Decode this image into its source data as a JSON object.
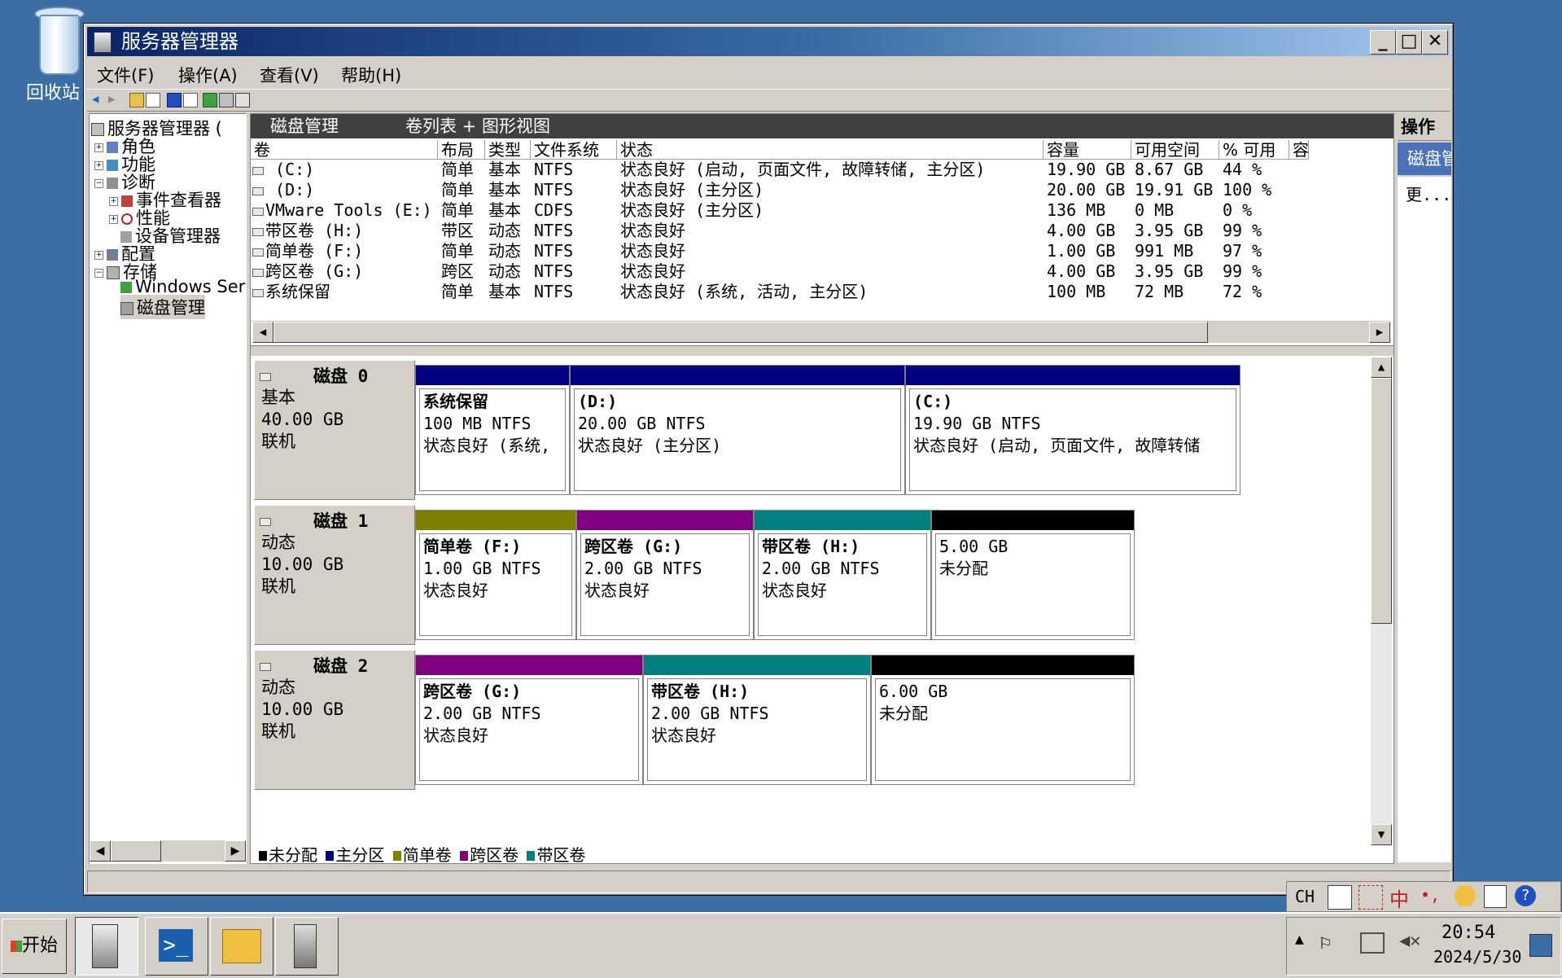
{
  "desktop": {
    "recycle_bin_label": "回收站"
  },
  "window": {
    "title": "服务器管理器",
    "controls": {
      "minimize": "_",
      "maximize": "□",
      "close": "✕"
    }
  },
  "menu": {
    "file": "文件(F)",
    "action": "操作(A)",
    "view": "查看(V)",
    "help": "帮助(H)"
  },
  "tree": {
    "root": "服务器管理器 (",
    "items": [
      {
        "label": "角色"
      },
      {
        "label": "功能"
      },
      {
        "label": "诊断"
      },
      {
        "label": "事件查看器"
      },
      {
        "label": "性能"
      },
      {
        "label": "设备管理器"
      },
      {
        "label": "配置"
      },
      {
        "label": "存储"
      },
      {
        "label": "Windows Ser"
      },
      {
        "label": "磁盘管理"
      }
    ]
  },
  "center": {
    "title": "磁盘管理",
    "view_label": "卷列表 + 图形视图",
    "columns": [
      "卷",
      "布局",
      "类型",
      "文件系统",
      "状态",
      "容量",
      "可用空间",
      "% 可用",
      "容"
    ],
    "rows": [
      {
        "vol": " (C:)",
        "layout": "简单",
        "type": "基本",
        "fs": "NTFS",
        "status": "状态良好 (启动, 页面文件, 故障转储, 主分区)",
        "cap": "19.90 GB",
        "free": "8.67 GB",
        "pct": "44 %"
      },
      {
        "vol": " (D:)",
        "layout": "简单",
        "type": "基本",
        "fs": "NTFS",
        "status": "状态良好 (主分区)",
        "cap": "20.00 GB",
        "free": "19.91 GB",
        "pct": "100 %"
      },
      {
        "vol": "VMware Tools (E:)",
        "layout": "简单",
        "type": "基本",
        "fs": "CDFS",
        "status": "状态良好 (主分区)",
        "cap": "136 MB",
        "free": "0 MB",
        "pct": "0 %"
      },
      {
        "vol": "带区卷 (H:)",
        "layout": "带区",
        "type": "动态",
        "fs": "NTFS",
        "status": "状态良好",
        "cap": "4.00 GB",
        "free": "3.95 GB",
        "pct": "99 %"
      },
      {
        "vol": "简单卷 (F:)",
        "layout": "简单",
        "type": "动态",
        "fs": "NTFS",
        "status": "状态良好",
        "cap": "1.00 GB",
        "free": "991 MB",
        "pct": "97 %"
      },
      {
        "vol": "跨区卷 (G:)",
        "layout": "跨区",
        "type": "动态",
        "fs": "NTFS",
        "status": "状态良好",
        "cap": "4.00 GB",
        "free": "3.95 GB",
        "pct": "99 %"
      },
      {
        "vol": "系统保留",
        "layout": "简单",
        "type": "基本",
        "fs": "NTFS",
        "status": "状态良好 (系统, 活动, 主分区)",
        "cap": "100 MB",
        "free": "72 MB",
        "pct": "72 %"
      }
    ],
    "disks": [
      {
        "title": "磁盘 0",
        "kind": "基本",
        "size": "40.00 GB",
        "state": "联机",
        "parts": [
          {
            "name": "系统保留",
            "size": "100 MB NTFS",
            "status": "状态良好 (系统,",
            "color": "#000080"
          },
          {
            "name": " (D:)",
            "size": "20.00 GB NTFS",
            "status": "状态良好 (主分区)",
            "color": "#000080"
          },
          {
            "name": " (C:)",
            "size": "19.90 GB NTFS",
            "status": "状态良好 (启动, 页面文件, 故障转储",
            "color": "#000080"
          }
        ]
      },
      {
        "title": "磁盘 1",
        "kind": "动态",
        "size": "10.00 GB",
        "state": "联机",
        "parts": [
          {
            "name": "简单卷 (F:)",
            "size": "1.00 GB NTFS",
            "status": "状态良好",
            "color": "#808000"
          },
          {
            "name": "跨区卷 (G:)",
            "size": "2.00 GB NTFS",
            "status": "状态良好",
            "color": "#800080"
          },
          {
            "name": "带区卷 (H:)",
            "size": "2.00 GB NTFS",
            "status": "状态良好",
            "color": "#008080"
          },
          {
            "name": "",
            "size": "5.00 GB",
            "status": "未分配",
            "color": "#000000"
          }
        ]
      },
      {
        "title": "磁盘 2",
        "kind": "动态",
        "size": "10.00 GB",
        "state": "联机",
        "parts": [
          {
            "name": "跨区卷 (G:)",
            "size": "2.00 GB NTFS",
            "status": "状态良好",
            "color": "#800080"
          },
          {
            "name": "带区卷 (H:)",
            "size": "2.00 GB NTFS",
            "status": "状态良好",
            "color": "#008080"
          },
          {
            "name": "",
            "size": "6.00 GB",
            "status": "未分配",
            "color": "#000000"
          }
        ]
      }
    ],
    "legend": [
      {
        "label": "未分配",
        "color": "#000000"
      },
      {
        "label": "主分区",
        "color": "#000080"
      },
      {
        "label": "简单卷",
        "color": "#808000"
      },
      {
        "label": "跨区卷",
        "color": "#800080"
      },
      {
        "label": "带区卷",
        "color": "#008080"
      }
    ]
  },
  "actions": {
    "title": "操作",
    "section": "磁盘管理",
    "more": "更..."
  },
  "taskbar": {
    "start": "开始",
    "tray": {
      "lang": "CH",
      "ime": "中",
      "time": "20:54",
      "date": "2024/5/30"
    }
  }
}
